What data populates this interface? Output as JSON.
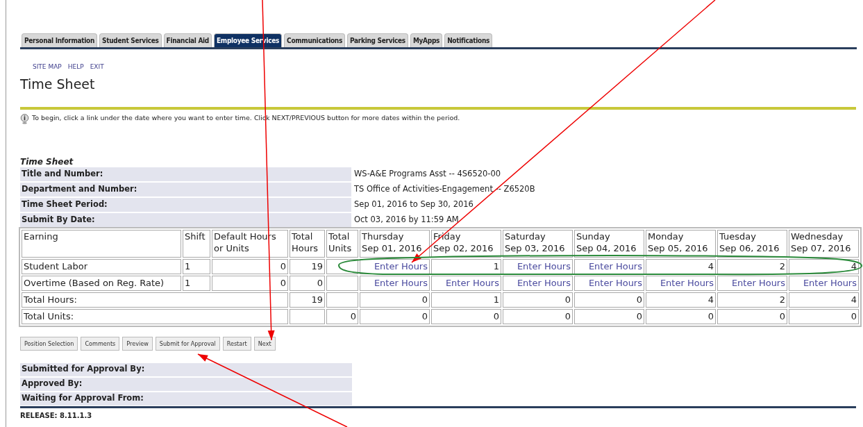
{
  "tabs": [
    {
      "label": "Personal Information",
      "selected": false
    },
    {
      "label": "Student Services",
      "selected": false
    },
    {
      "label": "Financial Aid",
      "selected": false
    },
    {
      "label": "Employee Services",
      "selected": true
    },
    {
      "label": "Communications",
      "selected": false
    },
    {
      "label": "Parking Services",
      "selected": false
    },
    {
      "label": "MyApps",
      "selected": false
    },
    {
      "label": "Notifications",
      "selected": false
    }
  ],
  "links": [
    "SITE MAP",
    "HELP",
    "EXIT"
  ],
  "title": "Time Sheet",
  "info": "To begin, click a link under the date where you want to enter time. Click NEXT/PREVIOUS button for more dates within the period.",
  "section_title": "Time Sheet",
  "details": [
    {
      "label": "Title and Number:",
      "value": "WS-A&E Programs Asst -- 4S6520-00"
    },
    {
      "label": "Department and Number:",
      "value": "TS Office of Activities-Engagement -- Z6520B"
    },
    {
      "label": "Time Sheet Period:",
      "value": "Sep 01, 2016 to Sep 30, 2016"
    },
    {
      "label": "Submit By Date:",
      "value": "Oct 03, 2016 by 11:59 AM"
    }
  ],
  "table": {
    "columns": [
      "Earning",
      "Shift",
      "Default Hours or Units",
      "Total Hours",
      "Total Units"
    ],
    "days": [
      {
        "day": "Thursday",
        "date": "Sep 01, 2016"
      },
      {
        "day": "Friday",
        "date": "Sep 02, 2016"
      },
      {
        "day": "Saturday",
        "date": "Sep 03, 2016"
      },
      {
        "day": "Sunday",
        "date": "Sep 04, 2016"
      },
      {
        "day": "Monday",
        "date": "Sep 05, 2016"
      },
      {
        "day": "Tuesday",
        "date": "Sep 06, 2016"
      },
      {
        "day": "Wednesday",
        "date": "Sep 07, 2016"
      }
    ],
    "rows": [
      {
        "kind": "earning",
        "earning": "Student Labor",
        "shift": "1",
        "default": "0",
        "total_hours": "19",
        "cells": [
          {
            "kind": "link",
            "text": "Enter Hours"
          },
          {
            "kind": "value",
            "text": "1"
          },
          {
            "kind": "link",
            "text": "Enter Hours"
          },
          {
            "kind": "link",
            "text": "Enter Hours"
          },
          {
            "kind": "value",
            "text": "4"
          },
          {
            "kind": "value",
            "text": "2"
          },
          {
            "kind": "value",
            "text": "4"
          }
        ]
      },
      {
        "kind": "earning",
        "earning": "Overtime (Based on Reg. Rate)",
        "shift": "1",
        "default": "0",
        "total_hours": "0",
        "cells": [
          {
            "kind": "link",
            "text": "Enter Hours"
          },
          {
            "kind": "link",
            "text": "Enter Hours"
          },
          {
            "kind": "link",
            "text": "Enter Hours"
          },
          {
            "kind": "link",
            "text": "Enter Hours"
          },
          {
            "kind": "link",
            "text": "Enter Hours"
          },
          {
            "kind": "link",
            "text": "Enter Hours"
          },
          {
            "kind": "link",
            "text": "Enter Hours"
          }
        ]
      },
      {
        "kind": "total",
        "label": "Total Hours:",
        "total_hours": "19",
        "cells": [
          {
            "kind": "value",
            "text": "0"
          },
          {
            "kind": "value",
            "text": "1"
          },
          {
            "kind": "value",
            "text": "0"
          },
          {
            "kind": "value",
            "text": "0"
          },
          {
            "kind": "value",
            "text": "4"
          },
          {
            "kind": "value",
            "text": "2"
          },
          {
            "kind": "value",
            "text": "4"
          }
        ]
      },
      {
        "kind": "total",
        "label": "Total Units:",
        "total_units": "0",
        "cells": [
          {
            "kind": "value",
            "text": "0"
          },
          {
            "kind": "value",
            "text": "0"
          },
          {
            "kind": "value",
            "text": "0"
          },
          {
            "kind": "value",
            "text": "0"
          },
          {
            "kind": "value",
            "text": "0"
          },
          {
            "kind": "value",
            "text": "0"
          },
          {
            "kind": "value",
            "text": "0"
          }
        ]
      }
    ]
  },
  "buttons": [
    "Position Selection",
    "Comments",
    "Preview",
    "Submit for Approval",
    "Restart",
    "Next"
  ],
  "approval": [
    "Submitted for Approval By:",
    "Approved By:",
    "Waiting for Approval From:"
  ],
  "release": "RELEASE: 8.11.1.3",
  "annotations": [
    {
      "kind": "arrow"
    },
    {
      "kind": "arrow"
    },
    {
      "kind": "arrow"
    },
    {
      "kind": "circle"
    }
  ]
}
